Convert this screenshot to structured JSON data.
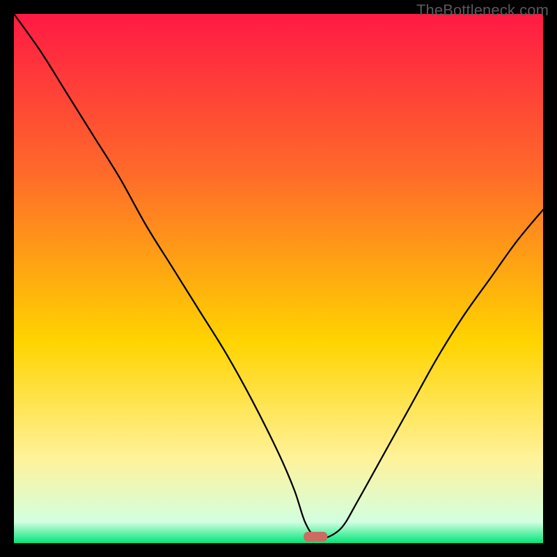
{
  "watermark": "TheBottleneck.com",
  "chart_data": {
    "type": "line",
    "title": "",
    "xlabel": "",
    "ylabel": "",
    "x_range": [
      0,
      100
    ],
    "y_range": [
      0,
      100
    ],
    "grid": false,
    "legend": false,
    "background_gradient": {
      "top": "#ff1a44",
      "upper_mid": "#ff6a2a",
      "mid": "#ffd400",
      "lower_mid": "#fff29a",
      "bottom": "#00e57a"
    },
    "marker": {
      "shape": "rounded-rect",
      "color": "#cb6b61",
      "x": 57,
      "y": 1.2
    },
    "series": [
      {
        "name": "bottleneck-curve",
        "color": "#000000",
        "stroke_width": 2.3,
        "x": [
          0,
          5,
          10,
          15,
          20,
          25,
          30,
          35,
          40,
          45,
          50,
          53,
          55,
          57,
          59,
          62,
          65,
          70,
          75,
          80,
          85,
          90,
          95,
          100
        ],
        "y": [
          100,
          93,
          85,
          77,
          69,
          60,
          52,
          44,
          36,
          27,
          17,
          10,
          4,
          1,
          1,
          3,
          8,
          17,
          26,
          35,
          43,
          50,
          57,
          63
        ]
      }
    ]
  }
}
